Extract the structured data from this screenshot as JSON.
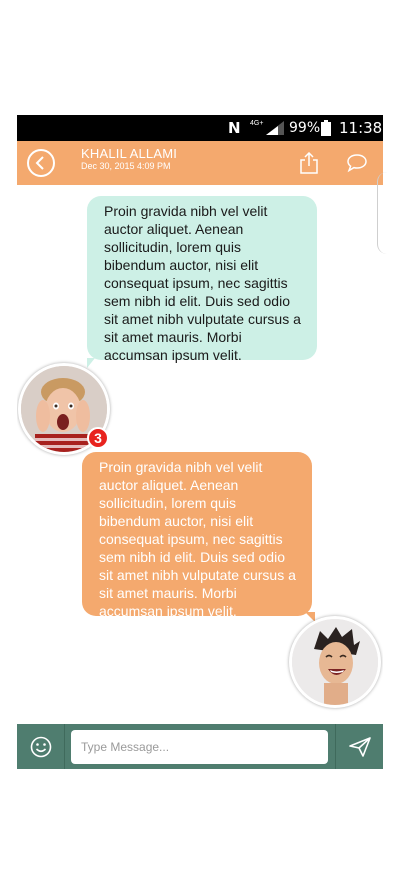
{
  "status_bar": {
    "nfc_icon": "N",
    "network_label": "4G+",
    "battery_percent": "99%",
    "time": "11:38"
  },
  "header": {
    "contact_name": "KHALIL ALLAMI",
    "contact_date": "Dec 30, 2015 4:09 PM",
    "icons": [
      "back-arrow-icon",
      "share-icon",
      "chat-bubble-icon"
    ],
    "color": "#f4a96e"
  },
  "messages": [
    {
      "direction": "received",
      "text": "Proin gravida nibh vel velit auctor aliquet. Aenean sollicitudin, lorem quis bibendum auctor, nisi elit consequat ipsum, nec sagittis sem nibh id elit. Duis sed odio sit amet nibh vulputate cursus a sit amet mauris. Morbi accumsan ipsum velit.",
      "color": "#cdf0e6"
    },
    {
      "direction": "sent",
      "text": "Proin gravida nibh vel velit auctor aliquet. Aenean sollicitudin, lorem quis bibendum auctor, nisi elit consequat ipsum, nec sagittis sem nibh id elit. Duis sed odio sit amet nibh vulputate cursus a sit amet mauris. Morbi accumsan ipsum velit.",
      "color": "#f4a96e"
    }
  ],
  "contact_avatar": {
    "badge_count": "3",
    "badge_color": "#e8231e"
  },
  "composer": {
    "placeholder": "Type Message...",
    "value": "",
    "color": "#4f7d6f",
    "icons": [
      "emoji-icon",
      "send-icon"
    ]
  }
}
